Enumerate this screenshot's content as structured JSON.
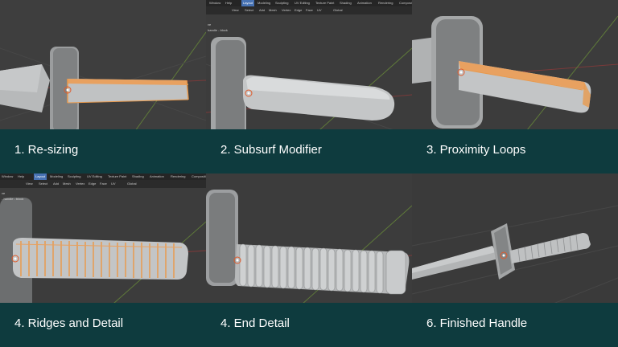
{
  "panels": [
    {
      "caption": "1. Re-sizing"
    },
    {
      "caption": "2. Subsurf Modifier",
      "menu": [
        "Window",
        "Help"
      ],
      "tabs": [
        "Layout",
        "Modeling",
        "Sculpting",
        "UV Editing",
        "Texture Paint",
        "Shading",
        "Animation",
        "Rendering",
        "Compositing"
      ],
      "toolbar": [
        "View",
        "Select",
        "Add",
        "Mesh",
        "Vertex",
        "Edge",
        "Face",
        "UV",
        "Global"
      ],
      "object_info": [
        "ve",
        "handle - block"
      ]
    },
    {
      "caption": "3. Proximity Loops"
    },
    {
      "caption": "4. Ridges and Detail",
      "menu": [
        "Window",
        "Help"
      ],
      "tabs": [
        "Layout",
        "Modeling",
        "Sculpting",
        "UV Editing",
        "Texture Paint",
        "Shading",
        "Animation",
        "Rendering",
        "Compositing"
      ],
      "toolbar": [
        "View",
        "Select",
        "Add",
        "Mesh",
        "Vertex",
        "Edge",
        "Face",
        "UV",
        "Global"
      ],
      "object_info": [
        "ve",
        "- handle - block"
      ]
    },
    {
      "caption": "4. End Detail"
    },
    {
      "caption": "6. Finished Handle"
    }
  ],
  "colors": {
    "caption_bg": "#0e3b3e",
    "viewport_bg": "#3d3d3d",
    "selection": "#e89a4e",
    "mesh": "#b9bcbe"
  }
}
